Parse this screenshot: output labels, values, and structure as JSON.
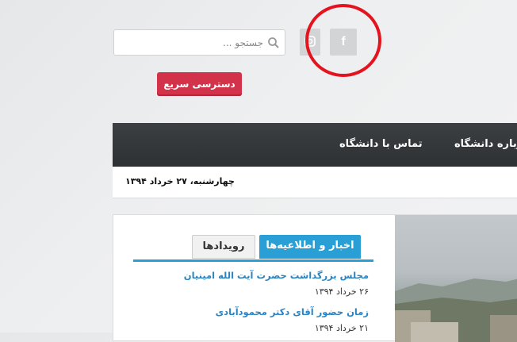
{
  "search": {
    "placeholder": "جستجو ..."
  },
  "social": {
    "facebook": "f"
  },
  "quick_access": {
    "label": "دسترسی سریع"
  },
  "nav": {
    "contact": "تماس با دانشگاه",
    "about": "درباره دانشگاه"
  },
  "date": "چهارشنبه، ۲۷ خرداد ۱۳۹۴",
  "tabs": {
    "news": "اخبار و اطلاعیه‌ها",
    "events": "رویدادها"
  },
  "news": [
    {
      "title": "مجلس بزرگداشت حضرت آیت الله امینیان",
      "date": "۲۶ خرداد ۱۳۹۴"
    },
    {
      "title": "زمان حضور آقای دکتر محمودآبادی",
      "date": "۲۱ خرداد ۱۳۹۴"
    }
  ],
  "colors": {
    "accent": "#2a9fd6",
    "quick_button": "#d2334a",
    "annotation": "#e4141e",
    "navbar": "#35383b"
  },
  "icons": [
    "search-icon",
    "facebook-icon",
    "instagram-icon"
  ]
}
